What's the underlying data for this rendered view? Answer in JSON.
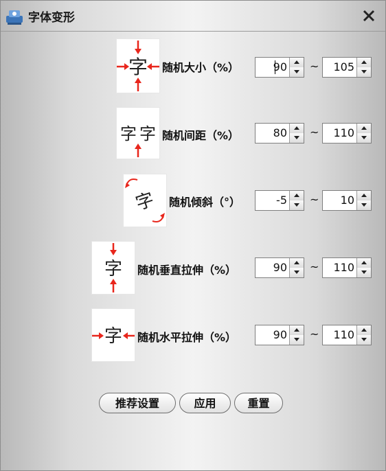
{
  "window": {
    "title": "字体变形",
    "icon": "font-tool-icon",
    "close_icon": "close-icon"
  },
  "preview_glyph": "字",
  "rows": [
    {
      "label": "随机大小（%）",
      "min": "90",
      "max": "105",
      "preview": "size-arrows"
    },
    {
      "label": "随机间距（%）",
      "min": "80",
      "max": "110",
      "preview": "spacing"
    },
    {
      "label": "随机倾斜（°）",
      "min": "-5",
      "max": "10",
      "preview": "rotate"
    },
    {
      "label": "随机垂直拉伸（%）",
      "min": "90",
      "max": "110",
      "preview": "vertical-stretch"
    },
    {
      "label": "随机水平拉伸（%）",
      "min": "90",
      "max": "110",
      "preview": "horizontal-stretch"
    }
  ],
  "separator": "~",
  "buttons": {
    "recommend": "推荐设置",
    "apply": "应用",
    "reset": "重置"
  },
  "colors": {
    "arrow": "#e8261c",
    "glyph": "#222222"
  }
}
